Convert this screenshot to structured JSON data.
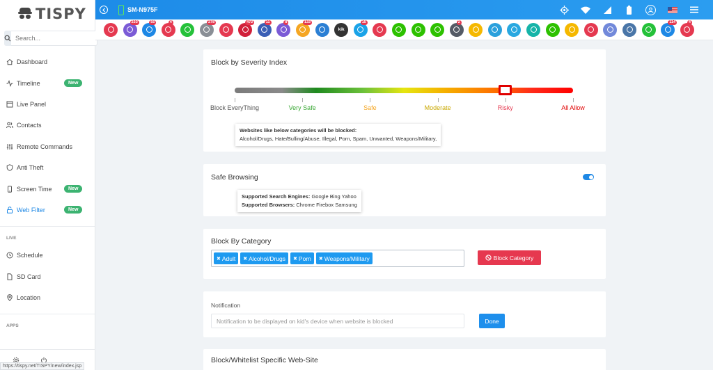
{
  "brand": {
    "name": "TISPY"
  },
  "sidebar": {
    "search_placeholder": "Search...",
    "items": [
      {
        "label": "Dashboard",
        "badge": ""
      },
      {
        "label": "Timeline",
        "badge": "New"
      },
      {
        "label": "Live Panel",
        "badge": ""
      },
      {
        "label": "Contacts",
        "badge": ""
      },
      {
        "label": "Remote Commands",
        "badge": ""
      },
      {
        "label": "Anti Theft",
        "badge": ""
      },
      {
        "label": "Screen Time",
        "badge": "New"
      },
      {
        "label": "Web Filter",
        "badge": "New"
      }
    ],
    "live_label": "LIVE",
    "live_items": [
      {
        "label": "Schedule"
      },
      {
        "label": "SD Card"
      },
      {
        "label": "Location"
      }
    ],
    "apps_label": "APPS",
    "status_url": "https://tispy.net/TISPY/new/index.jsp"
  },
  "topbar": {
    "device_name": "SM-N975F"
  },
  "app_strip": [
    {
      "name": "video",
      "color": "#e53950",
      "count": ""
    },
    {
      "name": "viber",
      "color": "#7b5bd6",
      "count": "233"
    },
    {
      "name": "messages",
      "color": "#1e88e5",
      "count": "55"
    },
    {
      "name": "gallery",
      "color": "#e53950",
      "count": "4"
    },
    {
      "name": "whatsapp",
      "color": "#25c13a",
      "count": ""
    },
    {
      "name": "keyboard",
      "color": "#8a8f96",
      "count": "278"
    },
    {
      "name": "calendar",
      "color": "#e53950",
      "count": ""
    },
    {
      "name": "browser",
      "color": "#d1203a",
      "count": "472"
    },
    {
      "name": "facebook",
      "color": "#3b5fb5",
      "count": "11"
    },
    {
      "name": "viber2",
      "color": "#7b5bd6",
      "count": "8"
    },
    {
      "name": "email",
      "color": "#f5a623",
      "count": "133"
    },
    {
      "name": "signal",
      "color": "#2b7fd4",
      "count": ""
    },
    {
      "name": "kik",
      "color": "#333333",
      "count": "",
      "text": "kik"
    },
    {
      "name": "skype",
      "color": "#1aa3e8",
      "count": "15"
    },
    {
      "name": "tinder",
      "color": "#e53950",
      "count": ""
    },
    {
      "name": "wechat",
      "color": "#2dc100",
      "count": ""
    },
    {
      "name": "line",
      "color": "#2dc100",
      "count": ""
    },
    {
      "name": "line2",
      "color": "#2dc100",
      "count": ""
    },
    {
      "name": "instagram",
      "color": "#555b66",
      "count": "2"
    },
    {
      "name": "snapchat",
      "color": "#f5b800",
      "count": ""
    },
    {
      "name": "telegram",
      "color": "#2ba0dc",
      "count": ""
    },
    {
      "name": "hike",
      "color": "#29a8e0",
      "count": ""
    },
    {
      "name": "bip",
      "color": "#16b4a8",
      "count": ""
    },
    {
      "name": "imo",
      "color": "#2dc100",
      "count": ""
    },
    {
      "name": "hangouts",
      "color": "#f5b800",
      "count": ""
    },
    {
      "name": "pinterest",
      "color": "#e53950",
      "count": ""
    },
    {
      "name": "discord",
      "color": "#7289da",
      "count": ""
    },
    {
      "name": "vk",
      "color": "#4a76a8",
      "count": ""
    },
    {
      "name": "tiktok",
      "color": "#25c13a",
      "count": ""
    },
    {
      "name": "other",
      "color": "#1e88e5",
      "count": "114"
    },
    {
      "name": "youtube",
      "color": "#e53950",
      "count": "4"
    }
  ],
  "severity": {
    "title": "Block by Severity Index",
    "labels": [
      {
        "text": "Block EveryThing",
        "color": "#555555"
      },
      {
        "text": "Very Safe",
        "color": "#3aa835"
      },
      {
        "text": "Safe",
        "color": "#f5a623"
      },
      {
        "text": "Moderate",
        "color": "#c9a800"
      },
      {
        "text": "Risky",
        "color": "#e53950"
      },
      {
        "text": "All Allow",
        "color": "#e00000"
      }
    ],
    "level_percent": 80,
    "info_title": "Websites like below categories will be blocked:",
    "info_text": "Alcohol/Drugs, Hate/Bulling/Abuse, Illegal, Porn, Spam, Unwanted, Weapons/Military,"
  },
  "safe_browsing": {
    "title": "Safe Browsing",
    "enabled": true,
    "engines_label": "Supported Search Engines:",
    "engines": "Google Bing Yahoo",
    "browsers_label": "Supported Browsers:",
    "browsers": "Chrome Firebox Samsung"
  },
  "category": {
    "title": "Block By Category",
    "tags": [
      "Adult",
      "Alcohol/Drugs",
      "Porn",
      "Weapons/Military"
    ],
    "button_label": "Block Category"
  },
  "notification": {
    "label": "Notification",
    "placeholder": "Notification to be displayed on kid's device when website is blocked",
    "button_label": "Done"
  },
  "whitelist": {
    "title": "Block/Whitelist Specific Web-Site"
  },
  "colors": {
    "accent": "#1e88e5",
    "danger": "#e6384f",
    "badge_new": "#3cb371"
  }
}
